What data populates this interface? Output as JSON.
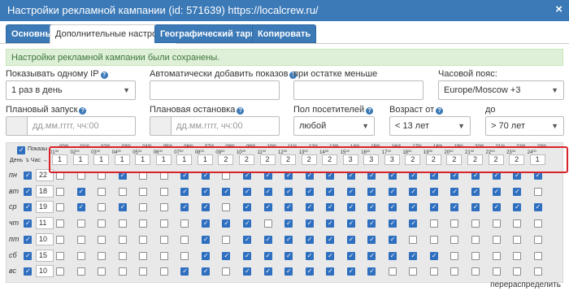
{
  "window": {
    "title": "Настройки рекламной кампании (id: 571639) https://localcrew.ru/",
    "close_label": "×"
  },
  "tabs": [
    {
      "label": "Основные"
    },
    {
      "label": "Дополнительные настройки"
    },
    {
      "label": "Географический таргетинг"
    },
    {
      "label": "Копировать"
    }
  ],
  "alert": {
    "text": "Настройки рекламной кампании были сохранены."
  },
  "help_glyph": "?",
  "calendar_icon": "calendar-icon",
  "form": {
    "show_per_ip": {
      "label": "Показывать одному IP",
      "value": "1 раз в день"
    },
    "auto_add": {
      "label": "Автоматически добавить показов",
      "value": ""
    },
    "remaining": {
      "label": "при остатке меньше",
      "value": ""
    },
    "timezone": {
      "label": "Часовой пояс:",
      "value": "Europe/Moscow +3"
    },
    "start": {
      "label": "Плановый запуск",
      "placeholder": "дд.мм.гггг, чч:00"
    },
    "stop": {
      "label": "Плановая остановка",
      "placeholder": "дд.мм.гггг, чч:00"
    },
    "gender": {
      "label": "Пол посетителей",
      "value": "любой"
    },
    "age_from": {
      "label": "Возраст от",
      "value": "< 13 лет"
    },
    "age_to": {
      "label": "до",
      "value": "> 70 лет"
    }
  },
  "schedule": {
    "shows_label": "Показы",
    "day_hour_label": "День ↴ Час →",
    "hour_labels": [
      "00",
      "01",
      "02",
      "03",
      "04",
      "05",
      "06",
      "07",
      "08",
      "09",
      "10",
      "11",
      "12",
      "13",
      "14",
      "15",
      "16",
      "17",
      "18",
      "19",
      "20",
      "21",
      "22",
      "23"
    ],
    "hour_ends": [
      "01",
      "02",
      "03",
      "04",
      "05",
      "06",
      "07",
      "08",
      "09",
      "10",
      "11",
      "12",
      "13",
      "14",
      "15",
      "16",
      "17",
      "18",
      "19",
      "20",
      "21",
      "22",
      "23",
      "24"
    ],
    "hour_values": [
      "1",
      "1",
      "1",
      "1",
      "1",
      "1",
      "1",
      "1",
      "2",
      "2",
      "2",
      "2",
      "2",
      "2",
      "3",
      "3",
      "3",
      "2",
      "2",
      "2",
      "2",
      "2",
      "2",
      "1"
    ],
    "days": [
      {
        "name": "пн",
        "count": "22",
        "hours": [
          0,
          0,
          0,
          1,
          0,
          0,
          1,
          1,
          0,
          1,
          1,
          1,
          1,
          1,
          1,
          1,
          1,
          1,
          1,
          1,
          1,
          1,
          1,
          1
        ]
      },
      {
        "name": "вт",
        "count": "18",
        "hours": [
          0,
          1,
          0,
          0,
          0,
          0,
          1,
          1,
          1,
          1,
          1,
          1,
          1,
          1,
          1,
          1,
          1,
          1,
          1,
          1,
          1,
          1,
          1,
          0
        ]
      },
      {
        "name": "ср",
        "count": "19",
        "hours": [
          0,
          1,
          0,
          1,
          0,
          0,
          1,
          1,
          0,
          1,
          1,
          1,
          1,
          1,
          1,
          1,
          1,
          1,
          1,
          1,
          1,
          1,
          1,
          1
        ]
      },
      {
        "name": "чт",
        "count": "11",
        "hours": [
          0,
          0,
          0,
          0,
          0,
          0,
          0,
          1,
          1,
          1,
          0,
          1,
          1,
          1,
          1,
          1,
          1,
          1,
          0,
          0,
          0,
          0,
          0,
          0
        ]
      },
      {
        "name": "пт",
        "count": "10",
        "hours": [
          0,
          0,
          0,
          0,
          0,
          0,
          0,
          1,
          0,
          1,
          1,
          1,
          1,
          1,
          1,
          1,
          1,
          0,
          0,
          0,
          0,
          0,
          0,
          0
        ]
      },
      {
        "name": "сб",
        "count": "15",
        "hours": [
          0,
          0,
          0,
          0,
          0,
          0,
          0,
          1,
          1,
          1,
          1,
          1,
          1,
          1,
          1,
          1,
          1,
          1,
          1,
          0,
          0,
          0,
          0,
          0
        ]
      },
      {
        "name": "вс",
        "count": "10",
        "hours": [
          0,
          0,
          0,
          0,
          0,
          0,
          1,
          1,
          0,
          1,
          1,
          1,
          1,
          1,
          1,
          1,
          0,
          0,
          0,
          0,
          0,
          0,
          0,
          0
        ]
      }
    ],
    "redistribute_label": "перераспределить"
  }
}
